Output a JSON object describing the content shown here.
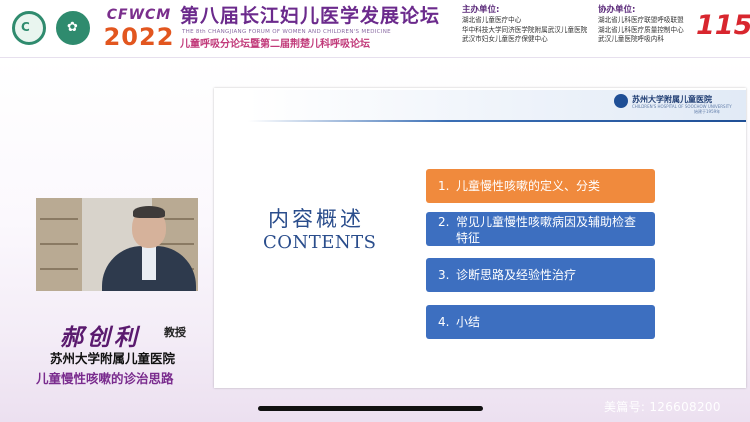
{
  "banner": {
    "brand_abbr": "CFWCM",
    "brand_year": "2022",
    "title": "第八届长江妇儿医学发展论坛",
    "title_en": "THE 8th CHANGJIANG FORUM OF WOMEN AND CHILDREN'S MEDICINE",
    "subtitle": "儿童呼吸分论坛暨第二届荆楚儿科呼吸论坛",
    "host": {
      "label": "主办单位:",
      "lines": [
        "湖北省儿童医疗中心",
        "华中科技大学同济医学院附属武汉儿童医院",
        "武汉市妇女儿童医疗保健中心"
      ]
    },
    "co_host": {
      "label": "协办单位:",
      "lines": [
        "湖北省儿科医疗联盟呼吸联盟",
        "湖北省儿科医疗质量控制中心",
        "武汉儿童医院呼吸内科"
      ]
    },
    "anniversary": "115"
  },
  "slide": {
    "hospital_name": "苏州大学附属儿童医院",
    "hospital_en": "CHILDREN'S HOSPITAL OF SOOCHOW UNIVERSITY",
    "hospital_est": "始建于1959年",
    "contents_cn": "内容概述",
    "contents_en": "CONTENTS",
    "items": [
      {
        "num": "1.",
        "text": "儿童慢性咳嗽的定义、分类"
      },
      {
        "num": "2.",
        "text": "常见儿童慢性咳嗽病因及辅助检查特征"
      },
      {
        "num": "3.",
        "text": "诊断思路及经验性治疗"
      },
      {
        "num": "4.",
        "text": "小结"
      }
    ],
    "colors": {
      "highlight": "#f08a3d",
      "item": "#3d6fc0",
      "heading": "#2a4d8c"
    }
  },
  "speaker": {
    "name": "郝创利",
    "title": "教授",
    "organization": "苏州大学附属儿童医院",
    "topic": "儿童慢性咳嗽的诊治思路"
  },
  "overlay": {
    "watermark": "美篇号: 126608200"
  }
}
